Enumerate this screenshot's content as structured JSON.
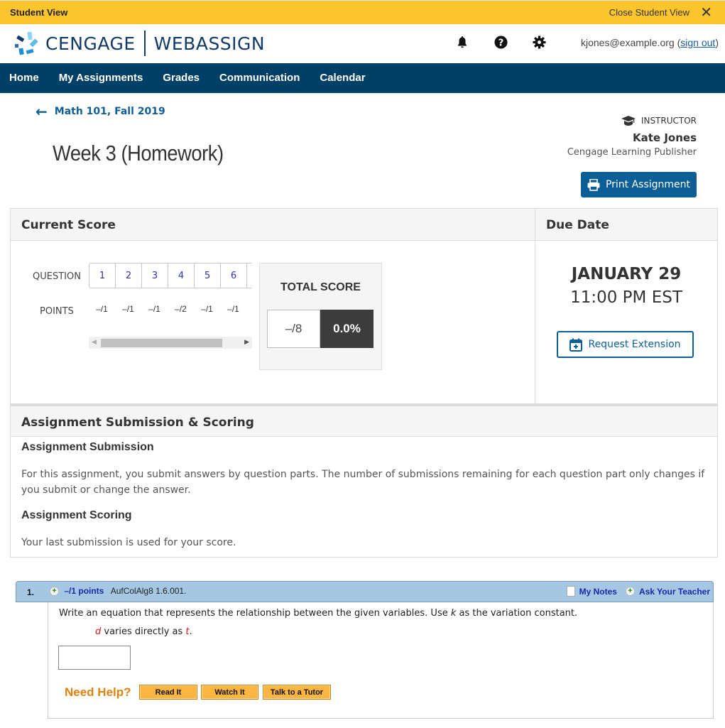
{
  "student_bar": {
    "label": "Student View",
    "close_label": "Close Student View",
    "close_icon": "✕"
  },
  "header": {
    "brand_primary": "CENGAGE",
    "brand_secondary": "WEBASSIGN",
    "user_email": "kjones@example.org",
    "sign_out": "sign out",
    "icons": [
      "bell-icon",
      "help-icon",
      "gear-icon"
    ]
  },
  "nav": {
    "items": [
      "Home",
      "My Assignments",
      "Grades",
      "Communication",
      "Calendar"
    ]
  },
  "page": {
    "back_label": "Math 101, Fall 2019",
    "title": "Week 3 (Homework)",
    "instructor_label": "INSTRUCTOR",
    "instructor_name": "Kate Jones",
    "instructor_org": "Cengage Learning Publisher",
    "print_label": "Print Assignment"
  },
  "score": {
    "heading": "Current Score",
    "question_label": "QUESTION",
    "points_label": "POINTS",
    "questions": [
      "1",
      "2",
      "3",
      "4",
      "5",
      "6"
    ],
    "points": [
      "–/1",
      "–/1",
      "–/1",
      "–/2",
      "–/1",
      "–/1"
    ],
    "total_label": "TOTAL SCORE",
    "total_points": "–/8",
    "total_percent": "0.0%"
  },
  "due": {
    "heading": "Due Date",
    "date": "JANUARY 29",
    "time": "11:00 PM EST",
    "extension_label": "Request Extension"
  },
  "submission": {
    "heading": "Assignment Submission & Scoring",
    "sub_heading": "Assignment Submission",
    "sub_text": "For this assignment, you submit answers by question parts. The number of submissions remaining for each question part only changes if you submit or change the answer.",
    "scoring_heading": "Assignment Scoring",
    "scoring_text": "Your last submission is used for your score."
  },
  "question": {
    "number": "1.",
    "points": "–/1 points",
    "source": "AufColAlg8 1.6.001.",
    "my_notes": "My Notes",
    "ask_teacher": "Ask Your Teacher",
    "prompt_pre": "Write an equation that represents the relationship between the given variables. Use ",
    "prompt_var": "k",
    "prompt_post": " as the variation constant.",
    "sub_var1": "d",
    "sub_mid": " varies directly as ",
    "sub_var2": "t",
    "sub_end": ".",
    "answer_value": "",
    "need_help": "Need Help?",
    "help_buttons": [
      "Read It",
      "Watch It",
      "Talk to a Tutor"
    ]
  }
}
